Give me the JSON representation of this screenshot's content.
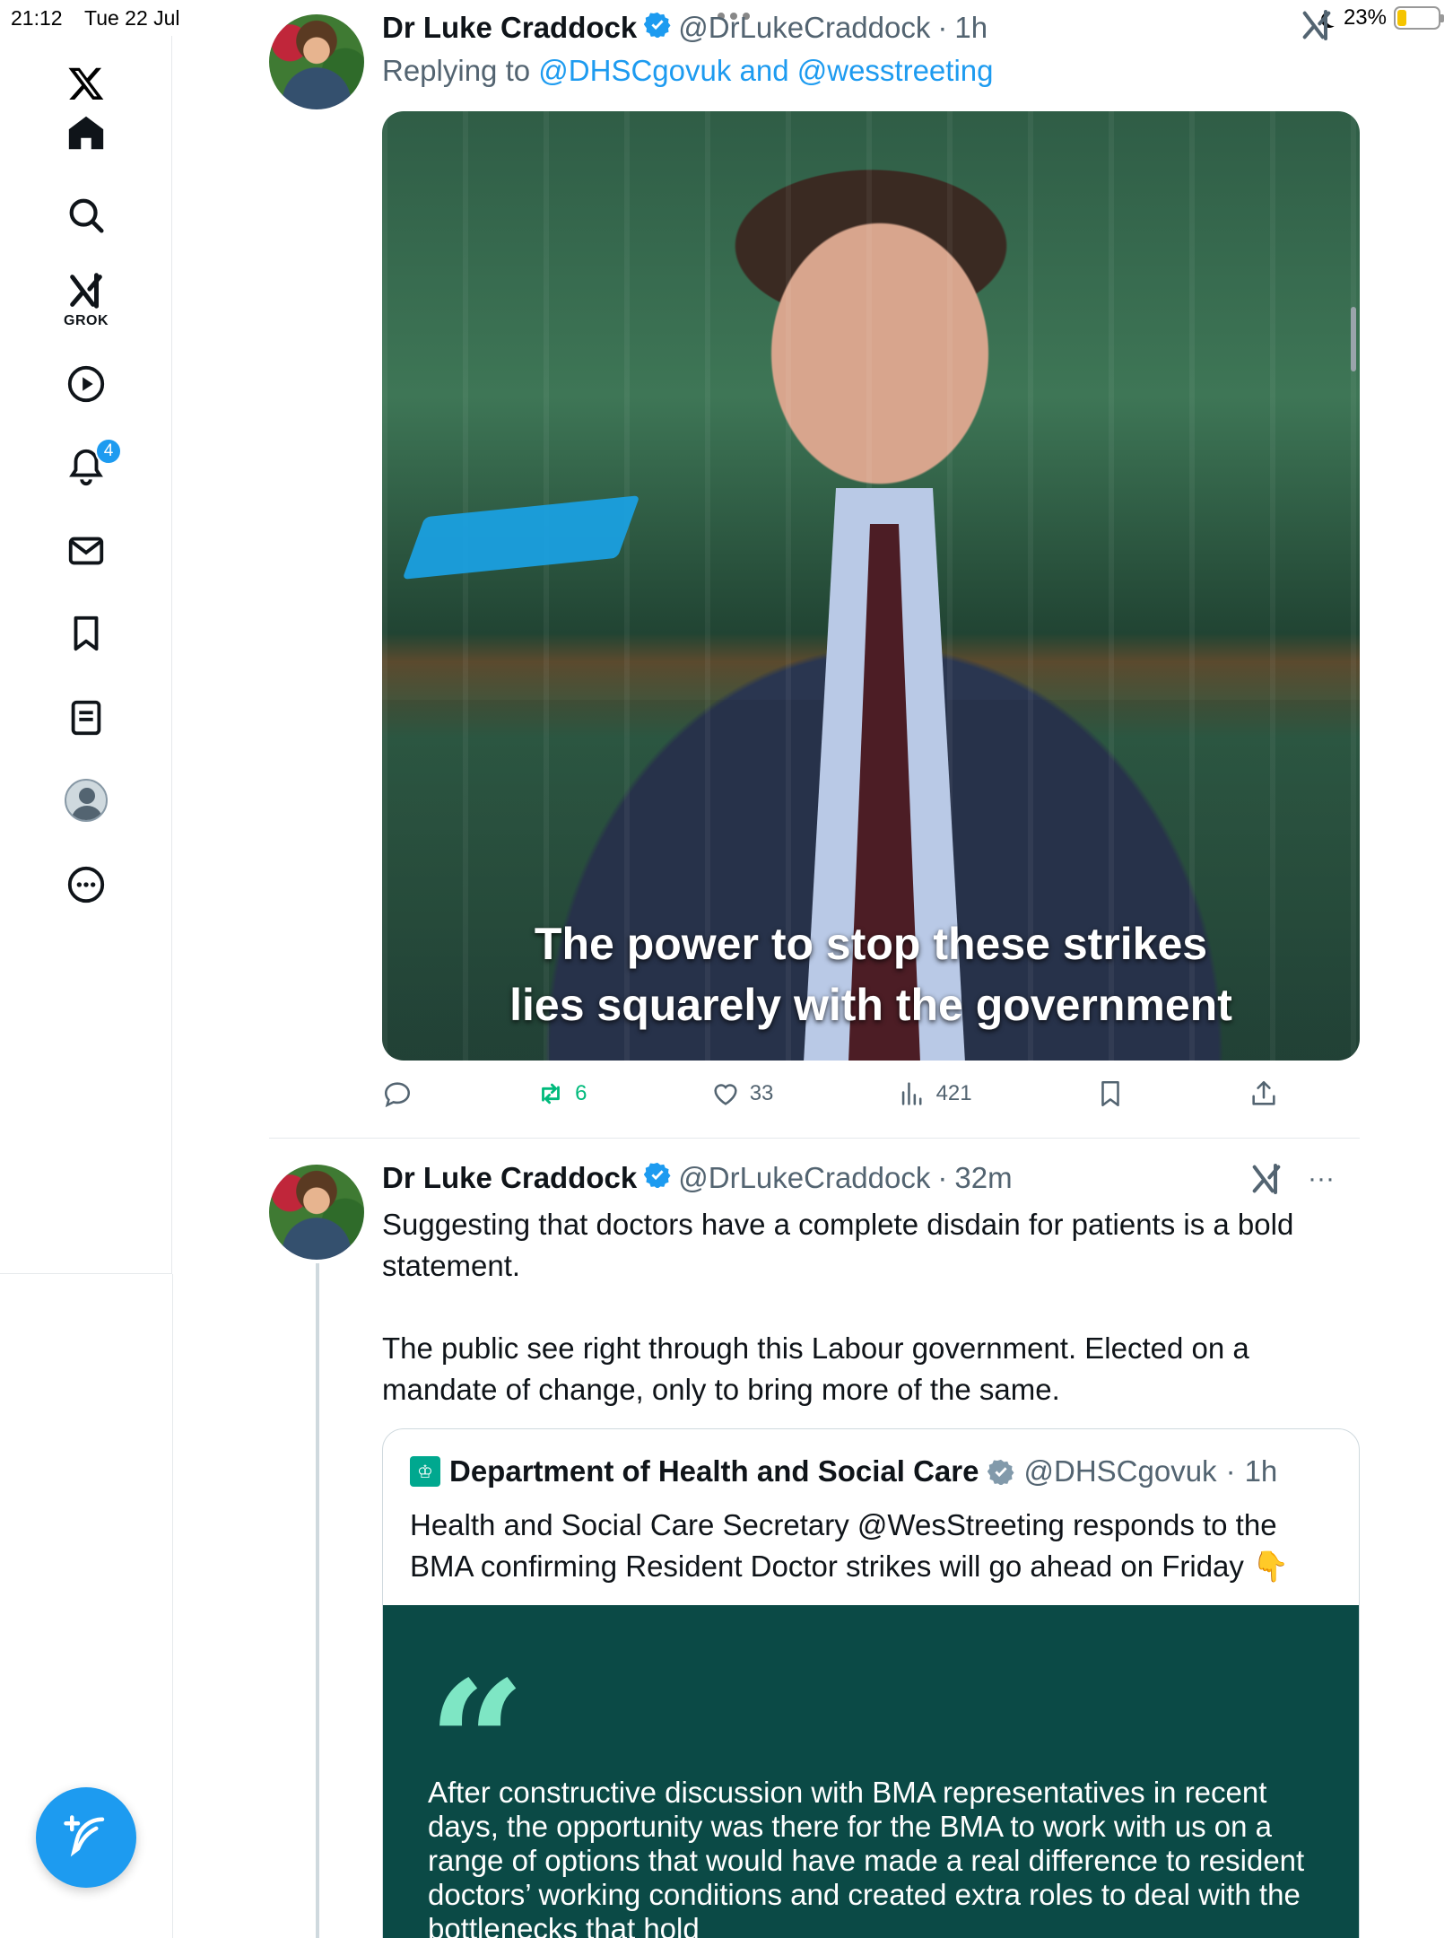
{
  "status_bar": {
    "time": "21:12",
    "date": "Tue 22 Jul",
    "battery": "23%",
    "battery_level": 0.23
  },
  "sidebar": {
    "items": [
      {
        "name": "x-logo"
      },
      {
        "name": "home"
      },
      {
        "name": "explore"
      },
      {
        "name": "grok",
        "label": "GROK"
      },
      {
        "name": "videos"
      },
      {
        "name": "notifications",
        "badge": "4"
      },
      {
        "name": "messages"
      },
      {
        "name": "bookmarks"
      },
      {
        "name": "lists"
      },
      {
        "name": "profile"
      },
      {
        "name": "more"
      }
    ],
    "compose_icon": "feather-plus-icon"
  },
  "tweets": [
    {
      "author": "Dr Luke Craddock",
      "handle": "@DrLukeCraddock",
      "dot": "·",
      "time": "1h",
      "reply_prefix": "Replying to",
      "reply_mentions": "@DHSCgovuk and @wesstreeting",
      "media_caption_line1": "The power to stop these strikes",
      "media_caption_line2": "lies squarely with the government",
      "actions": {
        "replies": "",
        "retweets": "6",
        "likes": "33",
        "views": "421"
      }
    },
    {
      "author": "Dr Luke Craddock",
      "handle": "@DrLukeCraddock",
      "dot": "·",
      "time": "32m",
      "more": "···",
      "text": "Suggesting that doctors have a complete disdain for patients is a bold statement.\n\nThe public see right through this Labour government. Elected on a mandate of change, only to bring more of the same.",
      "quote": {
        "author": "Department of Health and Social Care",
        "handle": "@DHSCgovuk",
        "dot": "·",
        "time": "1h",
        "text": "Health and Social Care Secretary @WesStreeting responds to the BMA confirming Resident Doctor strikes will go ahead on Friday 👇",
        "image_mark": "“",
        "image_text": "After constructive discussion with BMA representatives in recent days, the opportunity was there for the BMA to work with us on a range of options that would have made a real difference to resident doctors’ working conditions and created extra roles to deal with the bottlenecks that hold"
      }
    }
  ],
  "colors": {
    "accent": "#1d9bf0",
    "retweet": "#00ba7c",
    "quote_bg": "#0b4a46",
    "quote_mark": "#7ee6c4"
  }
}
